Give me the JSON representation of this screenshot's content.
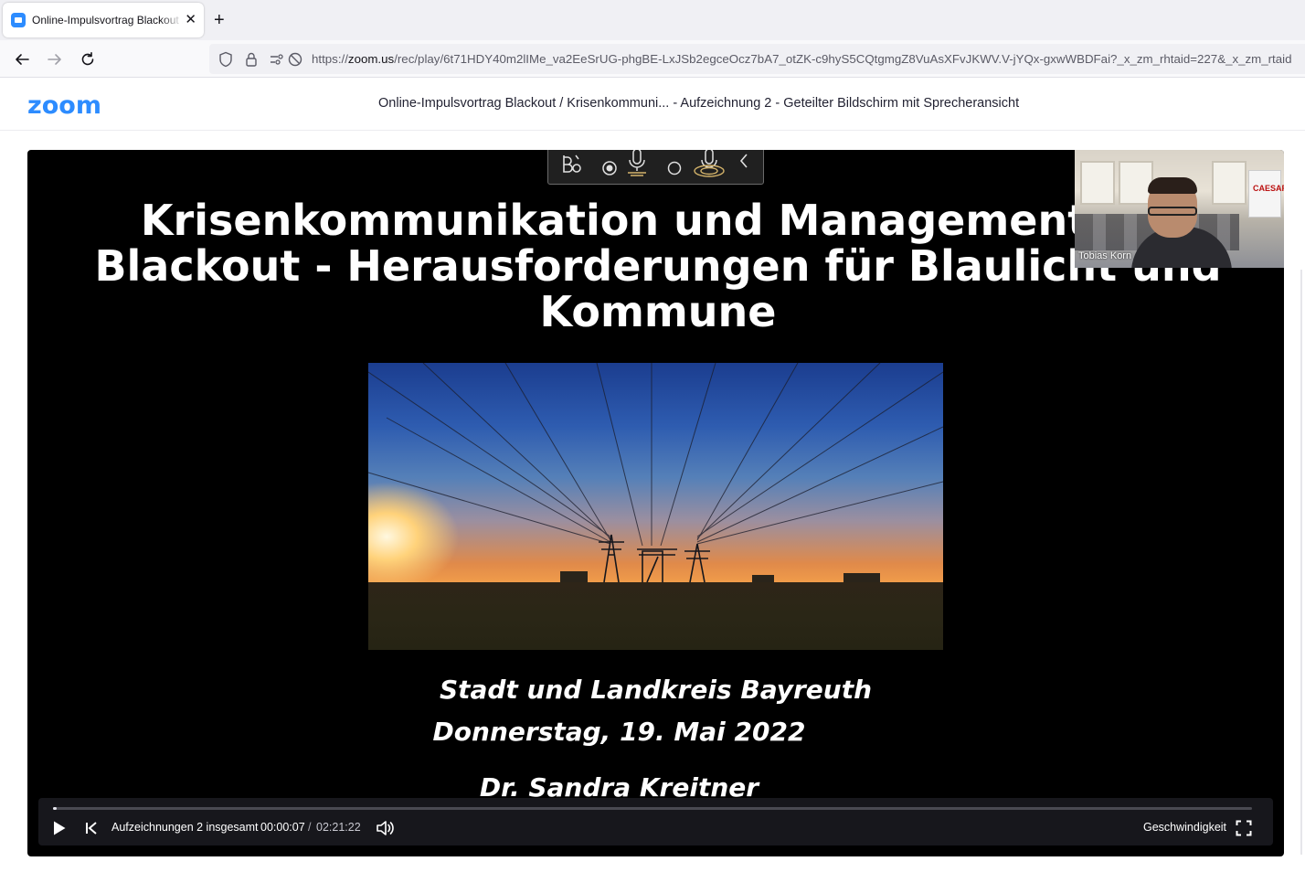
{
  "browser": {
    "tab_title": "Online-Impulsvortrag Blackout / Krisenkommunikation",
    "url_prefix": "https://",
    "url_domain": "zoom.us",
    "url_path": "/rec/play/6t71HDY40m2lIMe_va2EeSrUG-phgBE-LxJSb2egceOcz7bA7_otZK-c9hyS5CQtgmgZ8VuAsXFvJKWV.V-jYQx-gxwWBDFai?_x_zm_rhtaid=227&_x_zm_rtaid"
  },
  "header": {
    "logo": "zoom",
    "recording_title": "Online-Impulsvortrag Blackout / Krisenkommuni... - Aufzeichnung 2 - Geteilter Bildschirm mit Sprecheransicht"
  },
  "slide": {
    "title_line1": "Krisenkommunikation und Management bei",
    "title_line2": "Blackout - Herausforderungen für Blaulicht und",
    "title_line3": "Kommune",
    "location": "Stadt und Landkreis Bayreuth",
    "date": "Donnerstag, 19. Mai 2022",
    "speaker": "Dr. Sandra Kreitner"
  },
  "speaker_video": {
    "name": "Tobias Korn",
    "banner": "CAESAR"
  },
  "controls": {
    "recordings_label": "Aufzeichnungen 2 insgesamt",
    "current_time": "00:00:07",
    "separator": "/",
    "total_time": "02:21:22",
    "speed_label": "Geschwindigkeit",
    "progress_fraction": 0.0008
  },
  "icons": {
    "play": "play-icon",
    "previous": "skip-back-icon",
    "volume": "volume-icon",
    "fullscreen": "fullscreen-icon"
  },
  "colors": {
    "zoom_blue": "#2d8cff",
    "player_bg": "#000000"
  }
}
